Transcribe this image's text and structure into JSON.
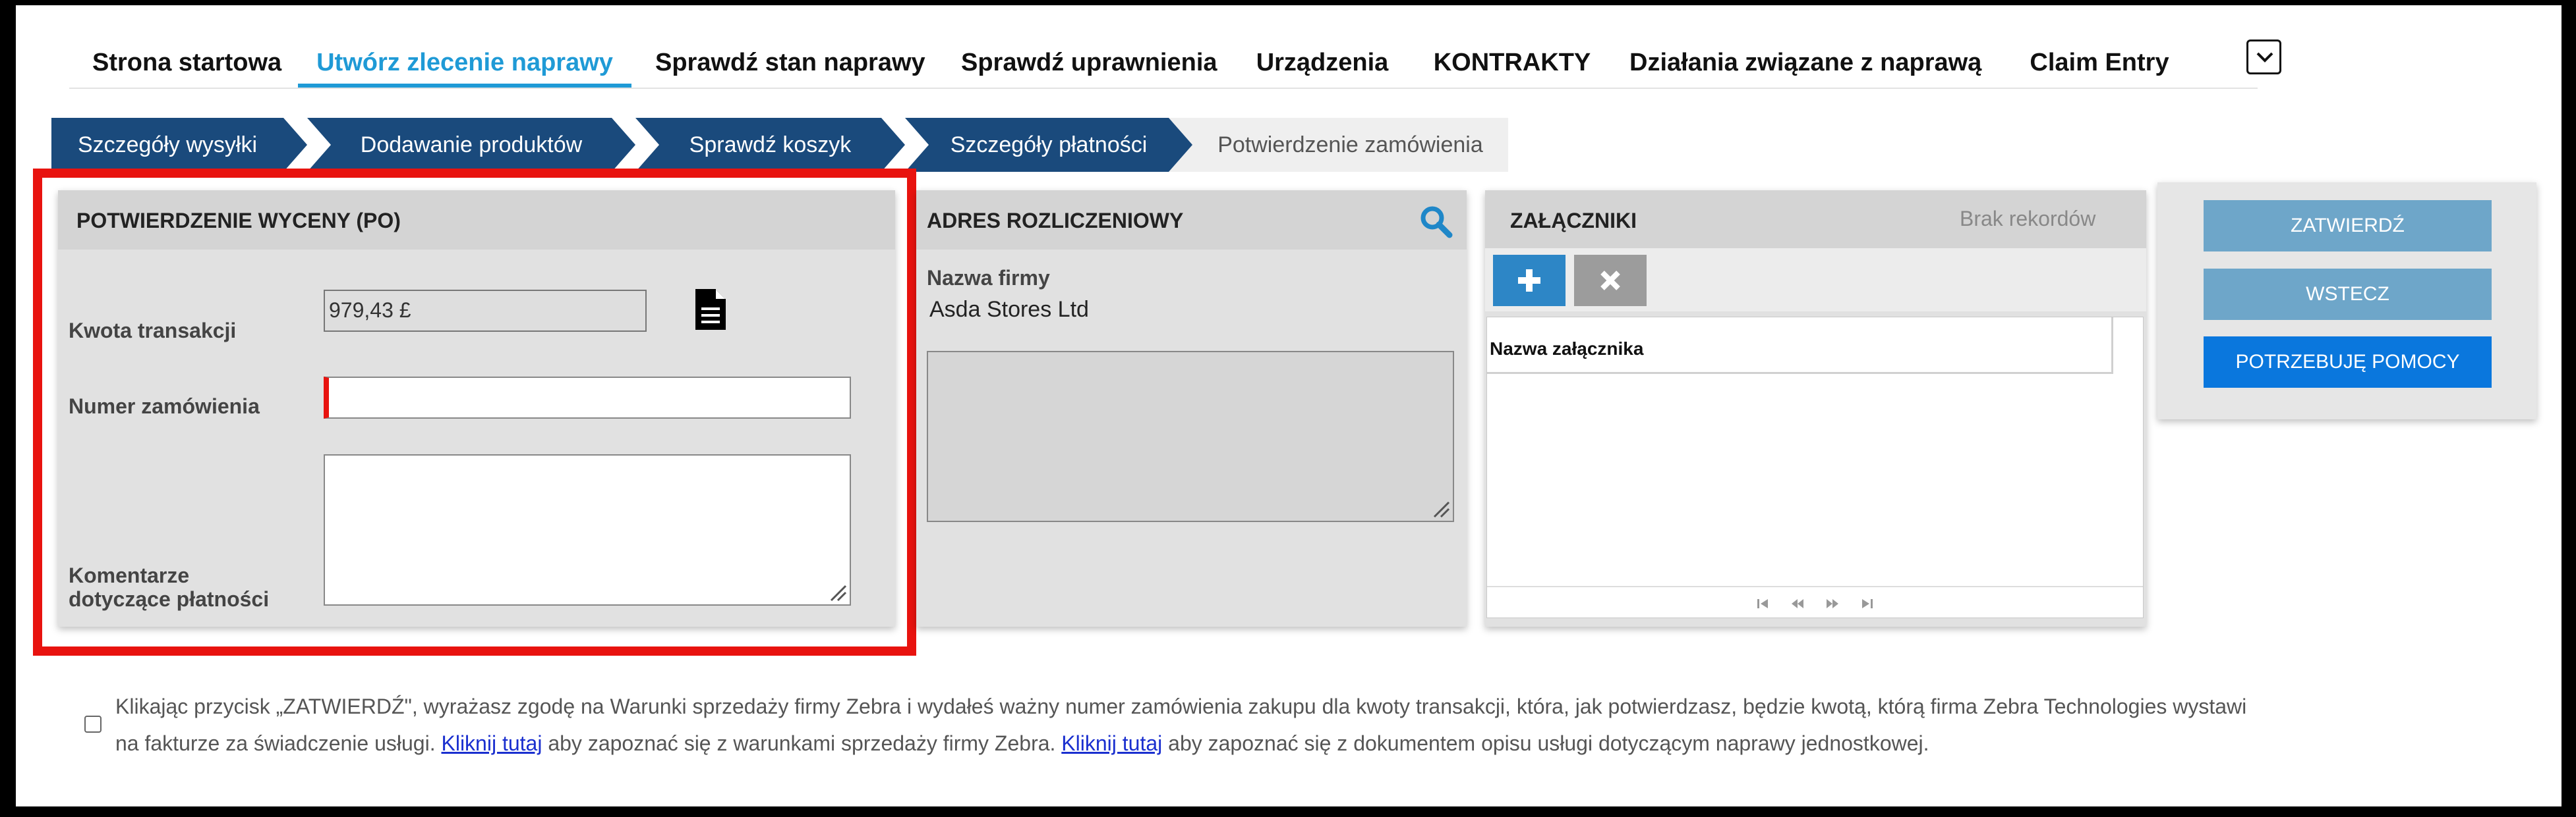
{
  "nav": {
    "items": [
      "Strona startowa",
      "Utwórz zlecenie naprawy",
      "Sprawdź stan naprawy",
      "Sprawdź uprawnienia",
      "Urządzenia",
      "KONTRAKTY",
      "Działania związane z naprawą",
      "Claim Entry"
    ],
    "active_index": 1
  },
  "steps": [
    "Szczegóły wysyłki",
    "Dodawanie produktów",
    "Sprawdź koszyk",
    "Szczegóły płatności",
    "Potwierdzenie zamówienia"
  ],
  "po_panel": {
    "title": "POTWIERDZENIE WYCENY (PO)",
    "amount_label": "Kwota transakcji",
    "amount_value": "979,43 £",
    "order_label": "Numer zamówienia",
    "order_value": "",
    "comments_label_line1": "Komentarze",
    "comments_label_line2": "dotyczące płatności",
    "comments_value": ""
  },
  "billing_panel": {
    "title": "ADRES ROZLICZENIOWY",
    "company_label": "Nazwa firmy",
    "company_value": "Asda Stores Ltd"
  },
  "attachments_panel": {
    "title": "ZAŁĄCZNIKI",
    "no_records": "Brak rekordów",
    "column_header": "Nazwa załącznika"
  },
  "actions": {
    "confirm": "ZATWIERDŹ",
    "back": "WSTECZ",
    "help": "POTRZEBUJĘ POMOCY"
  },
  "footer": {
    "text1": "Klikając przycisk „ZATWIERDŹ\", wyrażasz zgodę na Warunki sprzedaży firmy Zebra i wydałeś ważny numer zamówienia zakupu dla kwoty transakcji, która, jak potwierdzasz, będzie kwotą, którą firma Zebra Technologies wystawi na fakturze za świadczenie usługi.",
    "link1": "Kliknij tutaj",
    "text2": "aby zapoznać się z warunkami sprzedaży firmy Zebra.",
    "link2": "Kliknij tutaj",
    "text3": "aby zapoznać się z dokumentem opisu usługi dotyczącym naprawy jednostkowej."
  },
  "colors": {
    "accent": "#1f9ad6",
    "step_dark": "#1a4a7c",
    "highlight_red": "#e8130f",
    "button_gray_blue": "#6ea6c9",
    "button_blue": "#0a77dd"
  }
}
